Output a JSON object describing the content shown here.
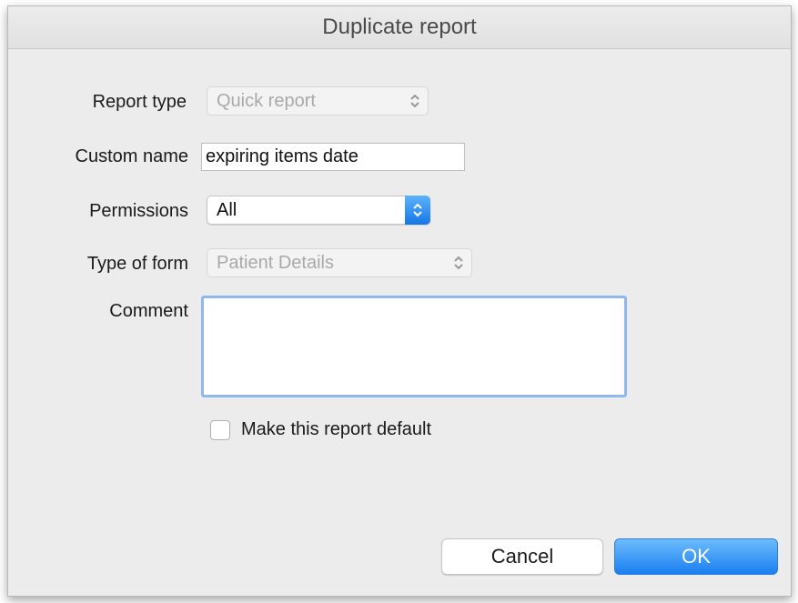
{
  "dialog": {
    "title": "Duplicate report"
  },
  "form": {
    "report_type": {
      "label": "Report type",
      "value": "Quick report"
    },
    "custom_name": {
      "label": "Custom name",
      "value": "expiring items date"
    },
    "permissions": {
      "label": "Permissions",
      "value": "All"
    },
    "type_of_form": {
      "label": "Type of form",
      "value": "Patient Details"
    },
    "comment": {
      "label": "Comment",
      "value": ""
    },
    "default_checkbox": {
      "label": "Make this report default",
      "checked": false
    }
  },
  "buttons": {
    "cancel": "Cancel",
    "ok": "OK"
  },
  "colors": {
    "accent": "#1b7ff0",
    "focus_ring": "#8fb9ec",
    "window_bg": "#ececec"
  }
}
